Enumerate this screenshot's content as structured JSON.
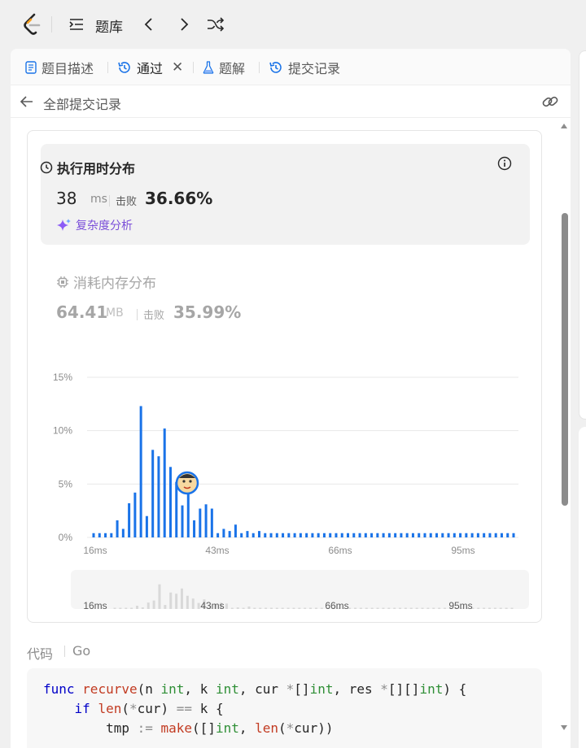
{
  "header": {
    "title": "题库"
  },
  "tabs": [
    {
      "label": "题目描述",
      "icon": "document-icon",
      "active": false
    },
    {
      "label": "通过",
      "icon": "history-icon",
      "active": true,
      "closable": true
    },
    {
      "label": "题解",
      "icon": "flask-icon",
      "active": false
    },
    {
      "label": "提交记录",
      "icon": "history-icon",
      "active": false
    }
  ],
  "back": {
    "label": "全部提交记录"
  },
  "runtime": {
    "title": "执行用时分布",
    "value": "38",
    "unit": "ms",
    "beat_label": "击败",
    "beat_value": "36.66%",
    "complexity_label": "复杂度分析"
  },
  "memory": {
    "title": "消耗内存分布",
    "value": "64.41",
    "unit": "MB",
    "beat_label": "击败",
    "beat_value": "35.99%"
  },
  "chart_data": {
    "type": "bar",
    "y_ticks": [
      "15%",
      "10%",
      "5%",
      "0%"
    ],
    "ylim": [
      0,
      15
    ],
    "x_tick_labels": [
      "16ms",
      "43ms",
      "66ms",
      "95ms"
    ],
    "values": [
      0.4,
      0.4,
      0.4,
      0.4,
      1.6,
      0.8,
      3.2,
      4.2,
      12.3,
      2.0,
      8.2,
      7.6,
      10.2,
      6.6,
      5.2,
      3.0,
      4.8,
      1.6,
      2.7,
      3.1,
      2.7,
      0.4,
      0.8,
      0.6,
      1.2,
      0.4,
      0.6,
      0.4,
      0.6,
      0.4,
      0.4,
      0.4,
      0.4,
      0.4,
      0.4,
      0.4,
      0.4,
      0.4,
      0.4,
      0.4,
      0.4,
      0.4,
      0.4,
      0.4,
      0.4,
      0.4,
      0.4,
      0.4,
      0.4,
      0.4,
      0.4,
      0.4,
      0.4,
      0.4,
      0.4,
      0.4,
      0.4,
      0.4,
      0.4,
      0.4,
      0.4,
      0.4,
      0.4,
      0.4,
      0.4,
      0.4,
      0.4,
      0.4,
      0.4,
      0.4,
      0.4,
      0.4
    ],
    "highlight_index": 15,
    "bar_color": "#1a73e8",
    "overview_color": "#d9d9d9",
    "grid": true
  },
  "code": {
    "label": "代码",
    "language": "Go",
    "lines": [
      "func recurve(n int, k int, cur *[]int, res *[][]int) {",
      "    if len(*cur) == k {",
      "        tmp := make([]int, len(*cur))"
    ]
  },
  "colors": {
    "accent": "#1a73e8",
    "purple": "#7b4fd9",
    "logo_orange": "#f89f1b"
  }
}
